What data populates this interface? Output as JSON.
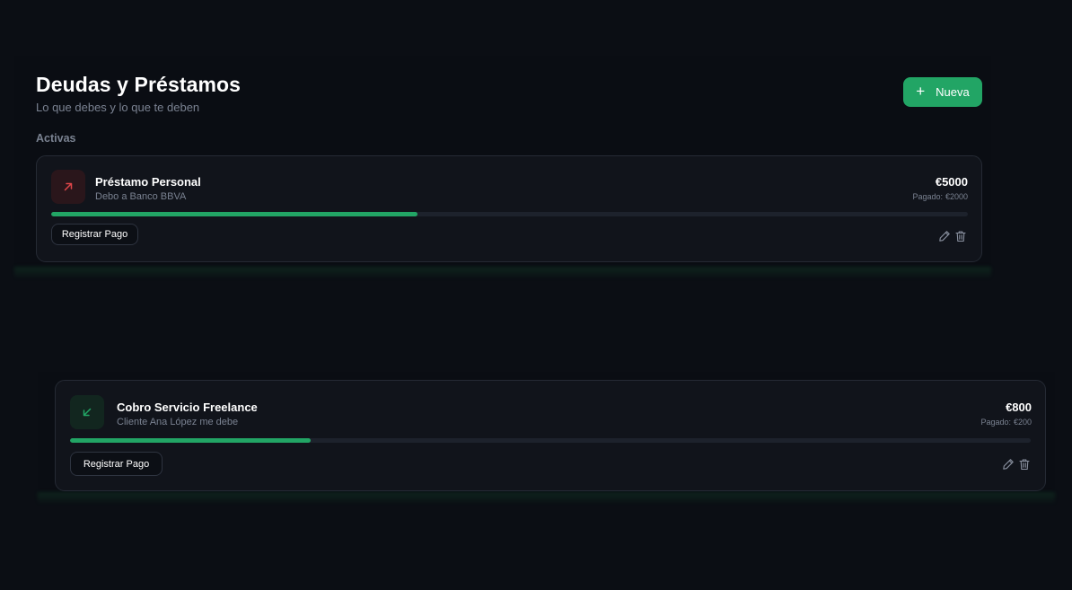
{
  "header": {
    "title": "Deudas y Préstamos",
    "subtitle": "Lo que debes y lo que te deben",
    "new_button_label": "Nueva"
  },
  "section": {
    "active_label": "Activas"
  },
  "colors": {
    "accent": "#22a565",
    "debt_icon": "#e0464a",
    "loan_icon": "#22a565",
    "background": "#0b0e14",
    "card": "#11141b"
  },
  "items": [
    {
      "type": "debt",
      "icon": "arrow-up-right-icon",
      "title": "Préstamo Personal",
      "description": "Debo a Banco BBVA",
      "amount": "€5000",
      "paid_label": "Pagado:",
      "paid_amount": "€2000",
      "progress": 0.4,
      "pay_button_label": "Registrar Pago"
    },
    {
      "type": "loan",
      "icon": "arrow-down-left-icon",
      "title": "Cobro Servicio Freelance",
      "description": "Cliente Ana López me debe",
      "amount": "€800",
      "paid_label": "Pagado:",
      "paid_amount": "€200",
      "progress": 0.25,
      "pay_button_label": "Registrar Pago"
    }
  ]
}
